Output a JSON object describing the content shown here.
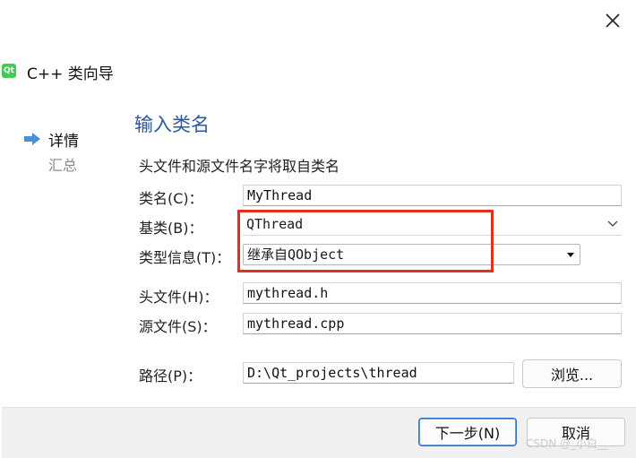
{
  "window": {
    "close_icon": "close-icon"
  },
  "wizard": {
    "logo_text": "Qt",
    "title": "C++ 类向导"
  },
  "steps": [
    {
      "label": "详情",
      "active": true
    },
    {
      "label": "汇总",
      "active": false
    }
  ],
  "section": {
    "title": "输入类名",
    "description": "头文件和源文件名字将取自类名"
  },
  "form": {
    "class_name": {
      "label": "类名(C)：",
      "value": "MyThread"
    },
    "base_class": {
      "label": "基类(B)：",
      "value": "QThread"
    },
    "type_info": {
      "label": "类型信息(T)：",
      "value": "继承自QObject"
    },
    "header_file": {
      "label": "头文件(H)：",
      "value": "mythread.h"
    },
    "source_file": {
      "label": "源文件(S)：",
      "value": "mythread.cpp"
    },
    "path": {
      "label": "路径(P)：",
      "value": "D:\\Qt_projects\\thread",
      "browse_label": "浏览..."
    }
  },
  "footer": {
    "next_label": "下一步(N)",
    "cancel_label": "取消"
  },
  "watermark": "CSDN @_小白__",
  "colors": {
    "title_blue": "#2b5b9a",
    "highlight_red": "#e3301c",
    "step_arrow_blue": "#4a8fd9"
  }
}
